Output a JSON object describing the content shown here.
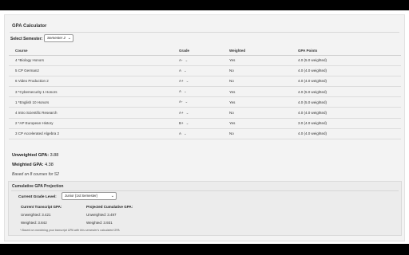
{
  "title": "GPA Calculator",
  "semester": {
    "label": "Select Semester:",
    "value": "Semester 2"
  },
  "table": {
    "headers": [
      "Course",
      "Grade",
      "Weighted",
      "GPA Points"
    ],
    "rows": [
      {
        "course": "4 *Biology Honors",
        "grade": "A-",
        "weighted": "Yes",
        "points": "4.0 (5.0 weighted)"
      },
      {
        "course": "5 CP German2",
        "grade": "A",
        "weighted": "No",
        "points": "4.0 (4.0 weighted)"
      },
      {
        "course": "6 Video Production 2",
        "grade": "A+",
        "weighted": "No",
        "points": "4.0 (4.0 weighted)"
      },
      {
        "course": "3 *Cybersecurity 1 Honors",
        "grade": "A",
        "weighted": "Yes",
        "points": "4.0 (5.0 weighted)"
      },
      {
        "course": "1 *English 10 Honors",
        "grade": "A-",
        "weighted": "Yes",
        "points": "4.0 (5.0 weighted)"
      },
      {
        "course": "4 Intro Scientific Research",
        "grade": "A+",
        "weighted": "No",
        "points": "4.0 (4.0 weighted)"
      },
      {
        "course": "2 *AP European History",
        "grade": "B+",
        "weighted": "Yes",
        "points": "3.0 (4.0 weighted)"
      },
      {
        "course": "3 CP Accelerated Algebra 2",
        "grade": "A",
        "weighted": "No",
        "points": "4.0 (4.0 weighted)"
      }
    ]
  },
  "summary": {
    "unweighted_label": "Unweighted GPA:",
    "unweighted_value": "3.88",
    "weighted_label": "Weighted GPA:",
    "weighted_value": "4.38",
    "basis": "Based on 8 courses for S2"
  },
  "projection": {
    "title": "Cumulative GPA Projection",
    "level_label": "Current Grade Level:",
    "level_value": "Junior (1st Semester)",
    "current_heading": "Current Transcript GPA:",
    "projected_heading": "Projected Cumulative GPA:",
    "current_unweighted": "Unweighted: 3.421",
    "current_weighted": "Weighted: 3.842",
    "projected_unweighted": "Unweighted: 3.497",
    "projected_weighted": "Weighted: 3.931",
    "note": "* Based on combining your transcript GPA with this semester's calculated GPA"
  },
  "icons": {
    "dropdown": "chevron-down-icon"
  }
}
